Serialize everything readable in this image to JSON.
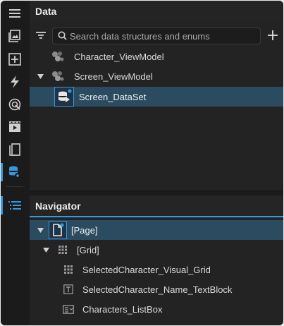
{
  "data_panel": {
    "title": "Data",
    "search_placeholder": "Search data structures and enums",
    "items": [
      {
        "label": "Character_ViewModel",
        "icon": "viewmodel-icon",
        "expanded": false
      },
      {
        "label": "Screen_ViewModel",
        "icon": "viewmodel-icon",
        "expanded": true
      },
      {
        "label": "Screen_DataSet",
        "icon": "dataset-icon",
        "selected": true
      }
    ]
  },
  "navigator": {
    "title": "Navigator",
    "items": [
      {
        "label": "[Page]",
        "icon": "page-icon",
        "selected": true
      },
      {
        "label": "[Grid]",
        "icon": "grid-icon"
      },
      {
        "label": "SelectedCharacter_Visual_Grid",
        "icon": "grid-icon"
      },
      {
        "label": "SelectedCharacter_Name_TextBlock",
        "icon": "textblock-icon"
      },
      {
        "label": "Characters_ListBox",
        "icon": "listbox-icon"
      }
    ]
  },
  "rail_icons": [
    "menu-icon",
    "gallery-icon",
    "add-box-icon",
    "lightning-icon",
    "target-icon",
    "media-icon",
    "bookmark-icon",
    "data-link-icon",
    "navigator-list-icon"
  ],
  "colors": {
    "accent": "#3a96dd",
    "selection": "#2b4b61",
    "background": "#1b1b1b",
    "panel": "#232323"
  }
}
